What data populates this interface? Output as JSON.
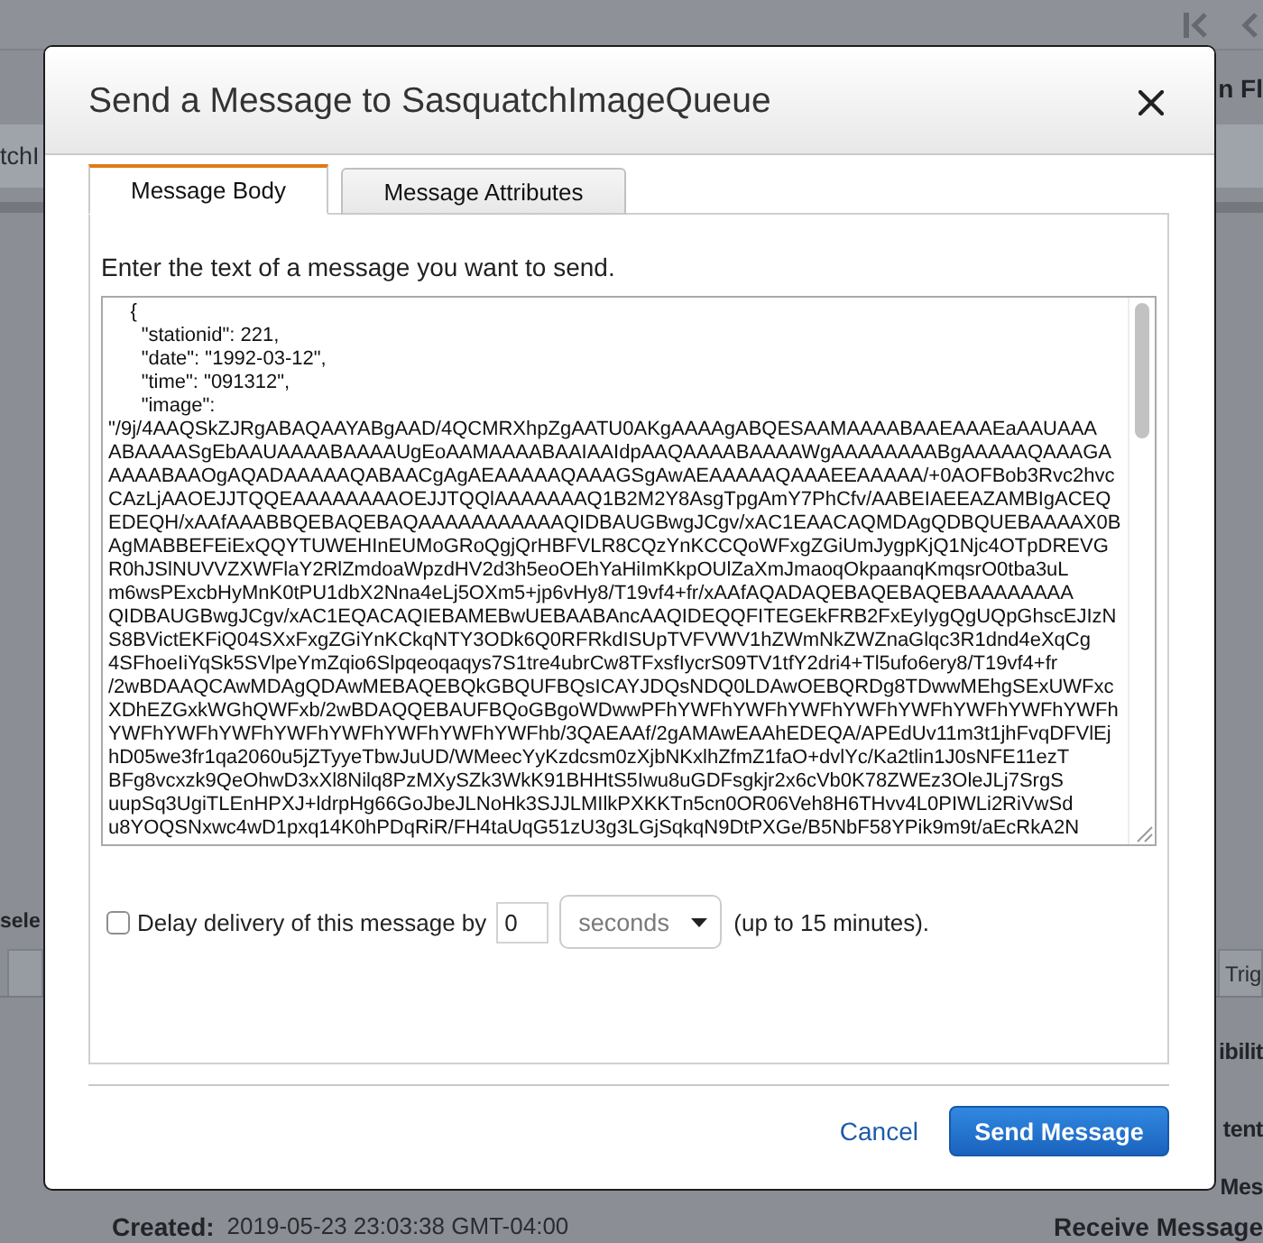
{
  "background_page": {
    "heading_fragment": "n Fl",
    "queue_tab_fragment": "tchI",
    "section_fragment": "sele",
    "tab_fragment": "Trig",
    "detail_fragments": [
      "ibilit",
      "tent",
      "Mes"
    ],
    "created": {
      "label": "Created:",
      "value": "2019-05-23 23:03:38 GMT-04:00"
    },
    "receive_fragment": "Receive Message"
  },
  "dialog": {
    "title": "Send a Message to SasquatchImageQueue",
    "tabs": [
      {
        "label": "Message Body",
        "selected": true
      },
      {
        "label": "Message Attributes",
        "selected": false
      }
    ],
    "instruction": "Enter the text of a message you want to send.",
    "message_body": {
      "value_lines": [
        "    {",
        "      \"stationid\": 221,",
        "      \"date\": \"1992-03-12\",",
        "      \"time\": \"091312\",",
        "      \"image\":",
        "\"/9j/4AAQSkZJRgABAQAAYABgAAD/4QCMRXhpZgAATU0AKgAAAAgABQESAAMAAAABAAEAAAEaAAUAAA",
        "ABAAAASgEbAAUAAAABAAAAUgEoAAMAAAABAAIAAIdpAAQAAAABAAAAWgAAAAAAAABgAAAAAQAAAGA",
        "AAAABAAOgAQADAAAAAQABAACgAgAEAAAAAQAAAGSgAwAEAAAAAQAAAEEAAAAA/+0AOFBob3Rvc2hvc",
        "CAzLjAAOEJJTQQEAAAAAAAAOEJJTQQlAAAAAAAQ1B2M2Y8AsgTpgAmY7PhCfv/AABEIAEEAZAMBIgACEQ",
        "EDEQH/xAAfAAABBQEBAQEBAQAAAAAAAAAAAQIDBAUGBwgJCgv/xAC1EAACAQMDAgQDBQUEBAAAAX0B",
        "AgMABBEFEiExQQYTUWEHInEUMoGRoQgjQrHBFVLR8CQzYnKCCQoWFxgZGiUmJygpKjQ1Njc4OTpDREVG",
        "R0hJSlNUVVZXWFlaY2RlZmdoaWpzdHV2d3h5eoOEhYaHiImKkpOUlZaXmJmaoqOkpaanqKmqsrO0tba3uL",
        "m6wsPExcbHyMnK0tPU1dbX2Nna4eLj5OXm5+jp6vHy8/T19vf4+fr/xAAfAQADAQEBAQEBAQEBAAAAAAAA",
        "QIDBAUGBwgJCgv/xAC1EQACAQIEBAMEBwUEBAABAncAAQIDEQQFITEGEkFRB2FxEyIygQgUQpGhscEJIzN",
        "S8BVictEKFiQ04SXxFxgZGiYnKCkqNTY3ODk6Q0RFRkdISUpTVFVWV1hZWmNkZWZnaGlqc3R1dnd4eXqCg",
        "4SFhoeIiYqSk5SVlpeYmZqio6Slpqeoqaqys7S1tre4ubrCw8TFxsfIycrS09TV1tfY2dri4+Tl5ufo6ery8/T19vf4+fr",
        "/2wBDAAQCAwMDAgQDAwMEBAQEBQkGBQUFBQsICAYJDQsNDQ0LDAwOEBQRDg8TDwwMEhgSExUWFxc",
        "XDhEZGxkWGhQWFxb/2wBDAQQEBAUFBQoGBgoWDwwPFhYWFhYWFhYWFhYWFhYWFhYWFhYWFhYWFh",
        "YWFhYWFhYWFhYWFhYWFhYWFhYWFhYWFhb/3QAEAAf/2gAMAwEAAhEDEQA/APEdUv11m3t1jhFvqDFVlEj",
        "hD05we3fr1qa2060u5jZTyyeTbwJuUD/WMeecYyKzdcsm0zXjbNKxlhZfmZ1faO+dvlYc/Ka2tlin1J0sNFE11ezT",
        "BFg8vcxzk9QeOhwD3xXl8Nilq8PzMXySZk3WkK91BHHtS5Iwu8uGDFsgkjr2x6cVb0K78ZWEz3OleJLj7SrgS",
        "uupSq3UgiTLEnHPXJ+ldrpHg66GoJbeJLNoHk3SJJLMIlkPXKKTn5cn0OR06Veh8H6THvv4L0PIWLi2RiVwSd",
        "u8YOQSNxwc4wD1pxq14K0hPDqRiR/FH4taUqG51zU3g3LGjSqkqN9DtPXGe/B5NbF58YPik9m9t/aEcRkA2N"
      ]
    },
    "delay": {
      "checked": false,
      "label": "Delay delivery of this message by",
      "value": "0",
      "unit": "seconds",
      "note": "(up to 15 minutes)."
    },
    "buttons": [
      {
        "kind": "link",
        "label": "Cancel"
      },
      {
        "kind": "primary",
        "label": "Send Message"
      }
    ]
  }
}
